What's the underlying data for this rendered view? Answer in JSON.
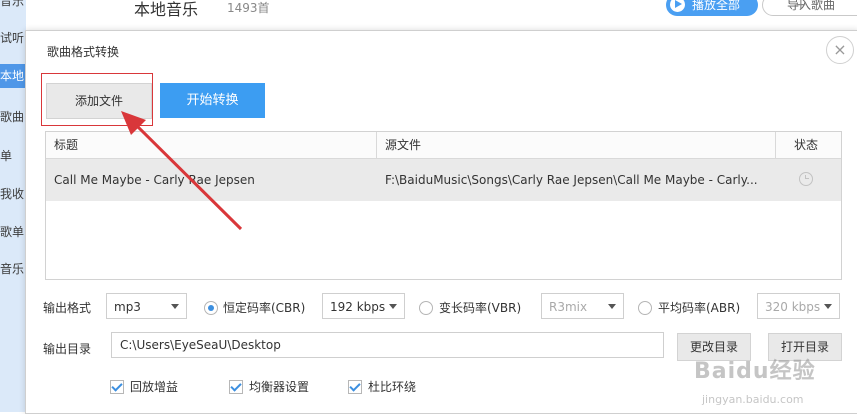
{
  "background": {
    "sidebar_items": [
      "音乐",
      "试听",
      "本地",
      "歌曲",
      "单",
      "我收",
      "歌单",
      "音乐"
    ],
    "page_title": "本地音乐",
    "track_count": "1493首",
    "play_all_label": "播放全部",
    "import_label": "导入歌曲"
  },
  "dialog": {
    "title": "歌曲格式转换",
    "add_file_label": "添加文件",
    "start_convert_label": "开始转换",
    "table": {
      "headers": [
        "标题",
        "源文件",
        "状态"
      ],
      "rows": [
        {
          "title": "Call Me Maybe - Carly Rae Jepsen",
          "source": "F:\\BaiduMusic\\Songs\\Carly Rae Jepsen\\Call Me Maybe - Carly...",
          "status_icon": "clock-icon"
        }
      ]
    },
    "output_format_label": "输出格式",
    "format_value": "mp3",
    "cbr_label": "恒定码率(CBR)",
    "cbr_value": "192 kbps",
    "vbr_label": "变长码率(VBR)",
    "vbr_value": "R3mix",
    "abr_label": "平均码率(ABR)",
    "abr_value": "320 kbps",
    "selected_bitrate_mode": "CBR",
    "output_dir_label": "输出目录",
    "output_dir_value": "C:\\Users\\EyeSeaU\\Desktop",
    "change_dir_label": "更改目录",
    "open_dir_label": "打开目录",
    "checkboxes": [
      {
        "label": "回放增益",
        "checked": true
      },
      {
        "label": "均衡器设置",
        "checked": true
      },
      {
        "label": "杜比环绕",
        "checked": true
      }
    ]
  },
  "watermark": {
    "main": "Baidu经验",
    "sub": "jingyan.baidu.com"
  },
  "colors": {
    "accent": "#3c9df2",
    "highlight": "#d9373a"
  }
}
